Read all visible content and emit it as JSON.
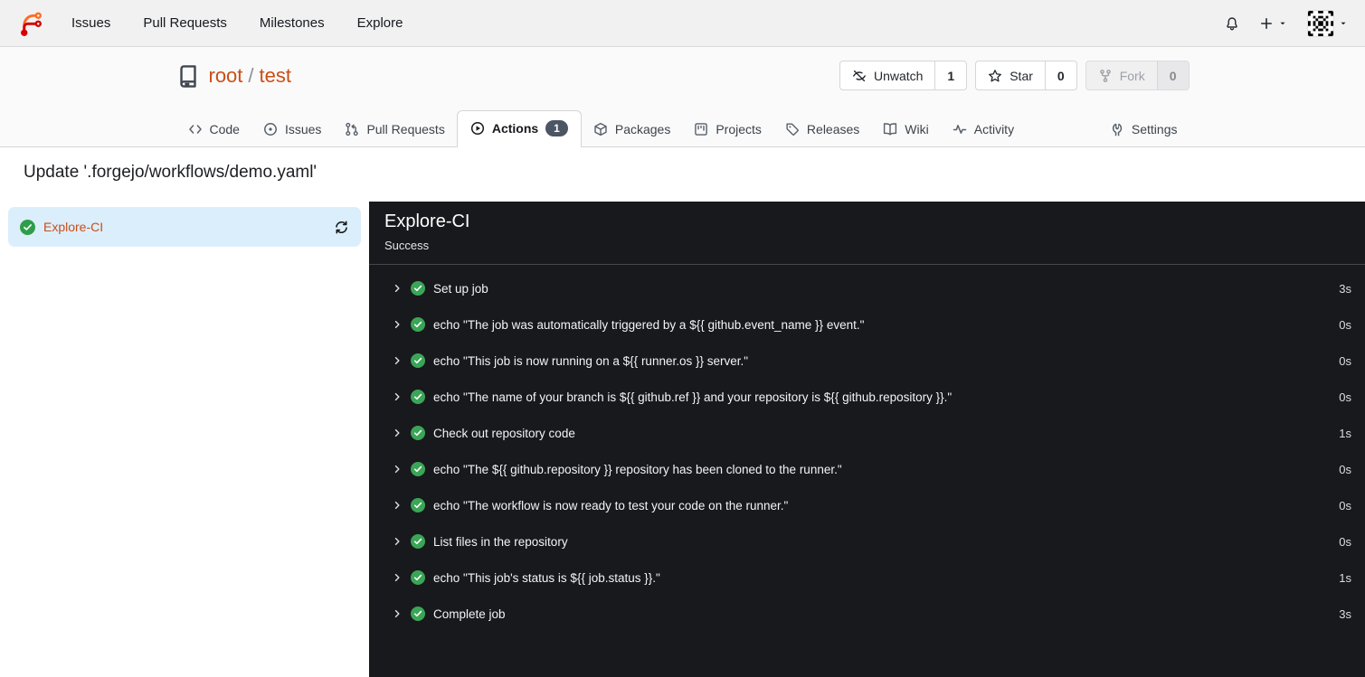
{
  "colors": {
    "link_accent": "#cb4e17",
    "success_green": "#3aa557",
    "panel_bg": "#17191c",
    "sidebar_selected_bg": "#dbeefb",
    "badge_bg": "#4b5563",
    "navbar_bg": "#f1f1f2"
  },
  "navbar": {
    "links": [
      {
        "label": "Issues"
      },
      {
        "label": "Pull Requests"
      },
      {
        "label": "Milestones"
      },
      {
        "label": "Explore"
      }
    ],
    "icons": [
      "bell-icon",
      "plus-icon",
      "avatar-identicon"
    ]
  },
  "repo": {
    "owner": "root",
    "separator": "/",
    "name": "test",
    "actions": {
      "watch": {
        "label": "Unwatch",
        "count": "1",
        "icon": "eye-slash-icon"
      },
      "star": {
        "label": "Star",
        "count": "0",
        "icon": "star-icon"
      },
      "fork": {
        "label": "Fork",
        "count": "0",
        "icon": "fork-icon",
        "disabled": true
      }
    }
  },
  "tabs": [
    {
      "label": "Code",
      "icon": "code-icon"
    },
    {
      "label": "Issues",
      "icon": "issue-icon"
    },
    {
      "label": "Pull Requests",
      "icon": "pull-request-icon"
    },
    {
      "label": "Actions",
      "icon": "play-circle-icon",
      "badge": "1",
      "active": true
    },
    {
      "label": "Packages",
      "icon": "package-icon"
    },
    {
      "label": "Projects",
      "icon": "project-board-icon"
    },
    {
      "label": "Releases",
      "icon": "tag-icon"
    },
    {
      "label": "Wiki",
      "icon": "book-open-icon"
    },
    {
      "label": "Activity",
      "icon": "pulse-icon"
    },
    {
      "label": "Settings",
      "icon": "tools-icon"
    }
  ],
  "page": {
    "title": "Update '.forgejo/workflows/demo.yaml'"
  },
  "run": {
    "sidebar": {
      "job_name": "Explore-CI"
    },
    "panel": {
      "title": "Explore-CI",
      "status": "Success"
    },
    "steps": [
      {
        "name": "Set up job",
        "duration": "3s"
      },
      {
        "name": "echo \"The job was automatically triggered by a ${{ github.event_name }} event.\"",
        "duration": "0s"
      },
      {
        "name": "echo \"This job is now running on a ${{ runner.os }} server.\"",
        "duration": "0s"
      },
      {
        "name": "echo \"The name of your branch is ${{ github.ref }} and your repository is ${{ github.repository }}.\"",
        "duration": "0s"
      },
      {
        "name": "Check out repository code",
        "duration": "1s"
      },
      {
        "name": "echo \"The ${{ github.repository }} repository has been cloned to the runner.\"",
        "duration": "0s"
      },
      {
        "name": "echo \"The workflow is now ready to test your code on the runner.\"",
        "duration": "0s"
      },
      {
        "name": "List files in the repository",
        "duration": "0s"
      },
      {
        "name": "echo \"This job's status is ${{ job.status }}.\"",
        "duration": "1s"
      },
      {
        "name": "Complete job",
        "duration": "3s"
      }
    ]
  }
}
